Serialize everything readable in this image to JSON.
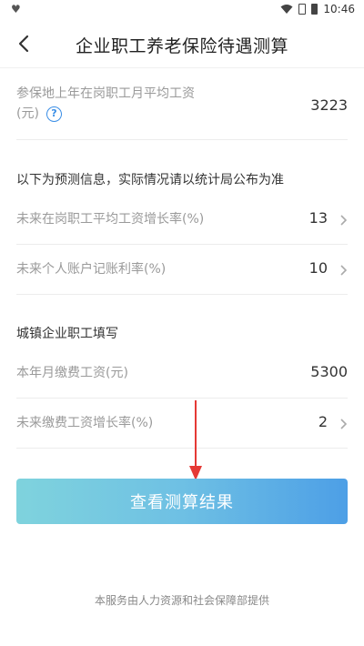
{
  "status_bar": {
    "left_icon": "♥",
    "time": "10:46"
  },
  "nav": {
    "title": "企业职工养老保险待遇测算",
    "back_icon": "chevron-left-icon"
  },
  "base_wage": {
    "label_line1": "参保地上年在岗职工月平均工资",
    "label_line2": "(元)",
    "value": "3223",
    "help_icon_glyph": "?"
  },
  "forecast_section": {
    "heading": "以下为预测信息，实际情况请以统计局公布为准",
    "rows": [
      {
        "label": "未来在岗职工平均工资增长率(%)",
        "value": "13"
      },
      {
        "label": "未来个人账户记账利率(%)",
        "value": "10"
      }
    ]
  },
  "urban_section": {
    "heading": "城镇企业职工填写",
    "rows": [
      {
        "label": "本年月缴费工资(元)",
        "value": "5300"
      },
      {
        "label": "未来缴费工资增长率(%)",
        "value": "2"
      }
    ]
  },
  "submit_button": {
    "label": "查看测算结果"
  },
  "footer": {
    "text": "本服务由人力资源和社会保障部提供"
  },
  "colors": {
    "accent": "#3a8ee6",
    "button_gradient_start": "#7fd3dd",
    "button_gradient_end": "#4d9fe6",
    "annotation_arrow": "#e53935"
  }
}
